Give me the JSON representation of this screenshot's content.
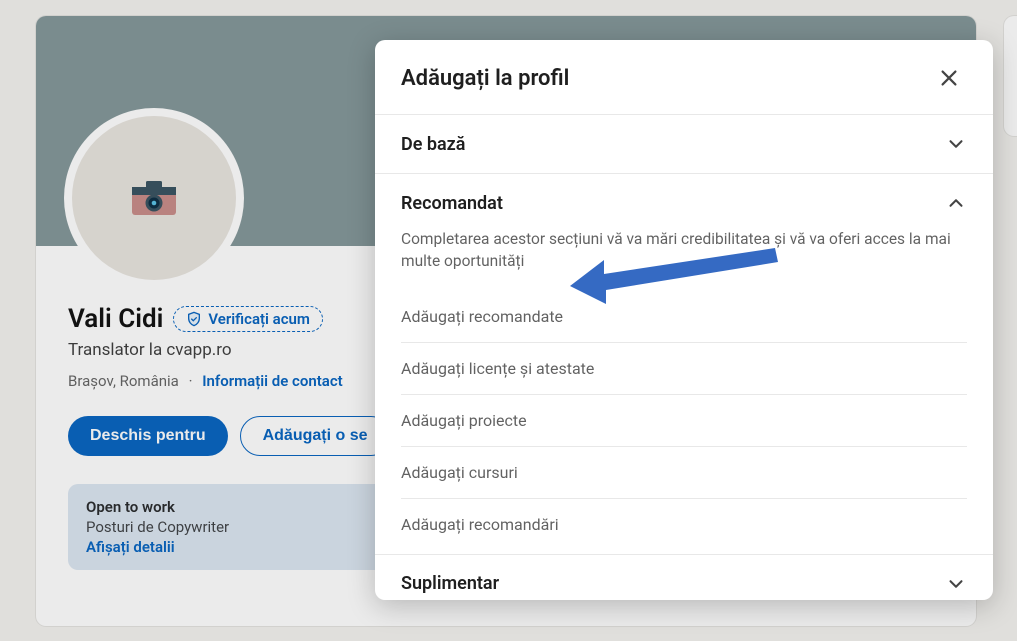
{
  "profile": {
    "name": "Vali Cidi",
    "verify_label": "Verificați acum",
    "headline": "Translator la cvapp.ro",
    "location": "Brașov, România",
    "contact_label": "Informații de contact",
    "open_to_label": "Deschis pentru",
    "add_section_label": "Adăugați o se",
    "open_to": {
      "title": "Open to work",
      "subtitle": "Posturi de Copywriter",
      "link": "Afișați detalii"
    }
  },
  "modal": {
    "title": "Adăugați la profil",
    "section_basic": "De bază",
    "recommended": {
      "title": "Recomandat",
      "description": "Completarea acestor secțiuni vă va mări credibilitatea și vă va oferi acces la mai multe oportunități",
      "items": [
        "Adăugați recomandate",
        "Adăugați licențe și atestate",
        "Adăugați proiecte",
        "Adăugați cursuri",
        "Adăugați recomandări"
      ]
    },
    "section_additional": "Suplimentar"
  }
}
